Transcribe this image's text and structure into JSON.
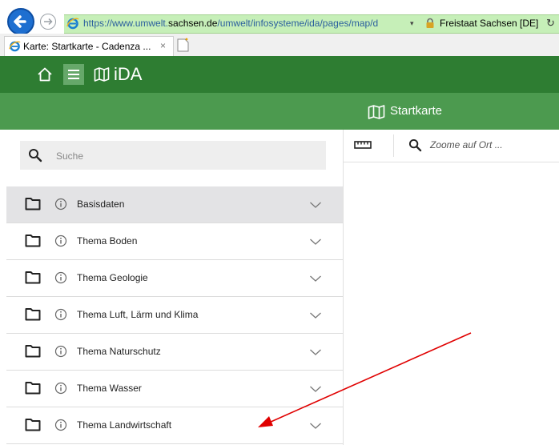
{
  "browser": {
    "url_prefix": "https://www.umwelt.",
    "url_domain": "sachsen.de",
    "url_path": "/umwelt/infosysteme/ida/pages/map/d",
    "url_dropdown": "▾",
    "site_identity": "Freistaat Sachsen [DE]",
    "refresh_glyph": "↻",
    "tab_title": "Karte: Startkarte - Cadenza ...",
    "tab_close": "×"
  },
  "app": {
    "title": "iDA",
    "subheader_title": "Startkarte"
  },
  "sidebar": {
    "search_placeholder": "Suche",
    "items": [
      {
        "label": "Basisdaten"
      },
      {
        "label": "Thema Boden"
      },
      {
        "label": "Thema Geologie"
      },
      {
        "label": "Thema Luft, Lärm und Klima"
      },
      {
        "label": "Thema Naturschutz"
      },
      {
        "label": "Thema Wasser"
      },
      {
        "label": "Thema Landwirtschaft"
      }
    ]
  },
  "map": {
    "zoom_placeholder": "Zoome auf Ort ..."
  },
  "colors": {
    "header": "#2e7d32",
    "subheader": "#4c9a4f",
    "address_bar": "#c6efb8",
    "active_row": "#e3e3e5",
    "annotation_arrow": "#e00000"
  },
  "icons": [
    "back-icon",
    "forward-icon",
    "ie-icon",
    "lock-icon",
    "home-icon",
    "menu-icon",
    "map-icon",
    "search-icon",
    "folder-icon",
    "info-icon",
    "chevron-down-icon",
    "ruler-icon"
  ]
}
